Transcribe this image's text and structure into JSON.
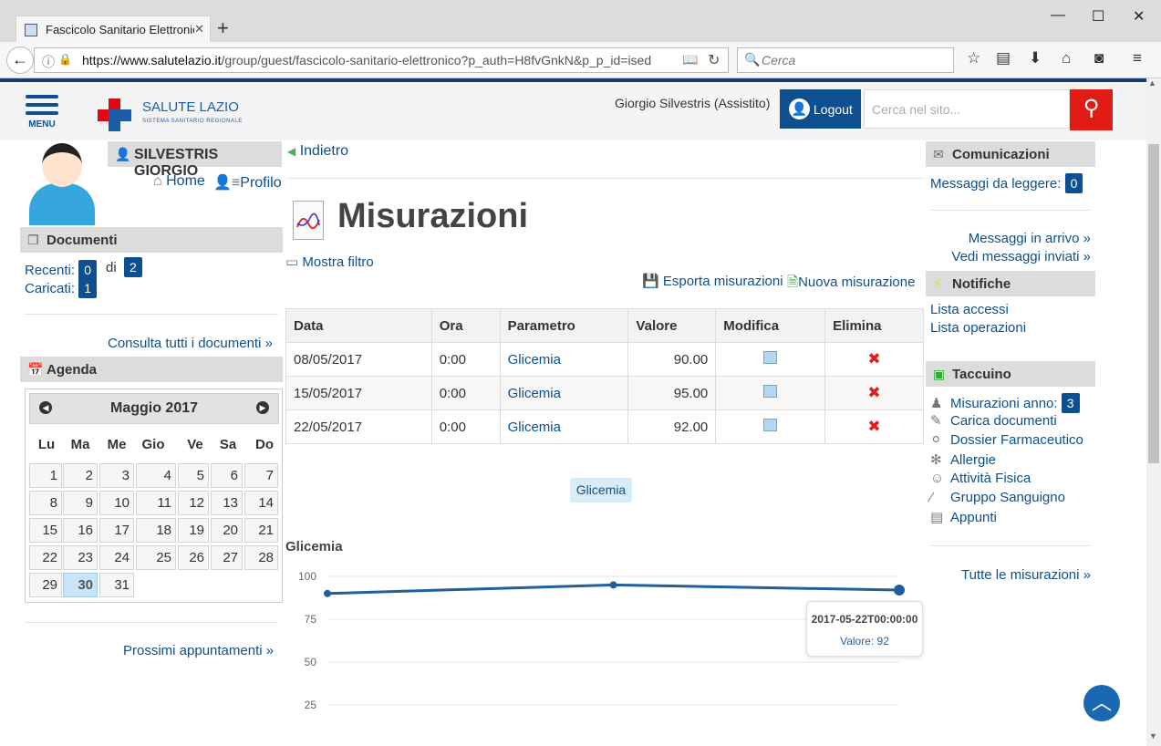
{
  "browser": {
    "tab_title": "Fascicolo Sanitario Elettronic",
    "url_host": "https://www.salutelazio.it",
    "url_rest": "/group/guest/fascicolo-sanitario-elettronico?p_auth=H8fvGnkN&p_p_id=ised",
    "search_placeholder": "Cerca"
  },
  "header": {
    "menu": "MENU",
    "brand": "SALUTE LAZIO",
    "brand_sub": "SISTEMA SANITARIO REGIONALE",
    "user": "Giorgio Silvestris (Assistito)",
    "logout": "Logout",
    "site_search": "Cerca nel sito..."
  },
  "left": {
    "name": "SILVESTRIS GIORGIO",
    "home": "Home",
    "profilo": "Profilo",
    "documenti": {
      "title": "Documenti",
      "recenti": "Recenti:",
      "recenti_count": "0",
      "di": "di",
      "total": "2",
      "caricati": "Caricati:",
      "caricati_count": "1",
      "link": "Consulta tutti i documenti »"
    },
    "agenda": {
      "title": "Agenda",
      "month": "Maggio 2017",
      "weekdays": [
        "Lu",
        "Ma",
        "Me",
        "Gio",
        "Ve",
        "Sa",
        "Do"
      ],
      "today": "30",
      "link": "Prossimi appuntamenti »"
    }
  },
  "main": {
    "back": "Indietro",
    "title": "Misurazioni",
    "filter": "Mostra filtro",
    "export": "Esporta misurazioni",
    "new": "Nuova misurazione",
    "columns": [
      "Data",
      "Ora",
      "Parametro",
      "Valore",
      "Modifica",
      "Elimina"
    ],
    "rows": [
      {
        "data": "08/05/2017",
        "ora": "0:00",
        "parametro": "Glicemia",
        "valore": "90.00"
      },
      {
        "data": "15/05/2017",
        "ora": "0:00",
        "parametro": "Glicemia",
        "valore": "95.00"
      },
      {
        "data": "22/05/2017",
        "ora": "0:00",
        "parametro": "Glicemia",
        "valore": "92.00"
      }
    ],
    "pill": "Glicemia",
    "chart_title": "Glicemia",
    "tooltip": {
      "date": "2017-05-22T00:00:00",
      "value": "Valore: 92"
    }
  },
  "chart_data": {
    "type": "line",
    "title": "Glicemia",
    "x": [
      "2017-05-08",
      "2017-05-15",
      "2017-05-22"
    ],
    "series": [
      {
        "values": [
          90,
          95,
          92
        ]
      }
    ],
    "y_ticks": [
      100,
      75,
      50,
      25
    ],
    "ylim": [
      0,
      100
    ],
    "color": "#1f5f9f"
  },
  "right": {
    "comunicazioni": {
      "title": "Comunicazioni",
      "messaggi": "Messaggi da leggere:",
      "count": "0",
      "in_arrivo": "Messaggi in arrivo »",
      "inviati": "Vedi messaggi inviati »"
    },
    "notifiche": {
      "title": "Notifiche",
      "accessi": "Lista accessi",
      "operazioni": "Lista operazioni"
    },
    "taccuino": {
      "title": "Taccuino",
      "misurazioni": "Misurazioni anno:",
      "count": "3",
      "items": [
        "Carica documenti",
        "Dossier Farmaceutico",
        "Allergie",
        "Attività Fisica",
        "Gruppo Sanguigno",
        "Appunti"
      ],
      "link": "Tutte le misurazioni »"
    }
  }
}
